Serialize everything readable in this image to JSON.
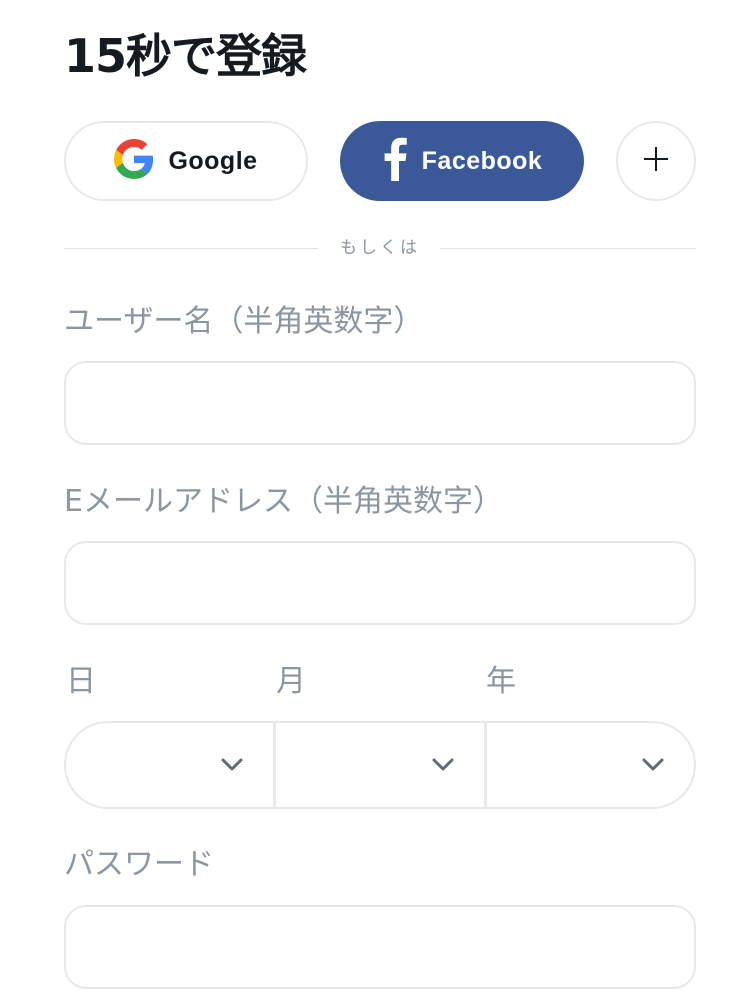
{
  "header": {
    "title": "15秒で登録"
  },
  "social": {
    "google_label": "Google",
    "facebook_label": "Facebook",
    "more_symbol": "+",
    "google_colors": {
      "blue": "#4285F4",
      "red": "#EA4335",
      "yellow": "#FBBC05",
      "green": "#34A853"
    },
    "facebook_color": "#3b5998"
  },
  "divider": {
    "text": "もしくは"
  },
  "form": {
    "username": {
      "label": "ユーザー名（半角英数字）",
      "value": "",
      "placeholder": ""
    },
    "email": {
      "label": "Eメールアドレス（半角英数字）",
      "value": "",
      "placeholder": ""
    },
    "birthdate": {
      "day_label": "日",
      "month_label": "月",
      "year_label": "年",
      "day_value": "",
      "month_value": "",
      "year_value": "",
      "icon": "chevron-down-icon"
    },
    "password": {
      "label": "パスワード",
      "value": "",
      "placeholder": ""
    }
  }
}
